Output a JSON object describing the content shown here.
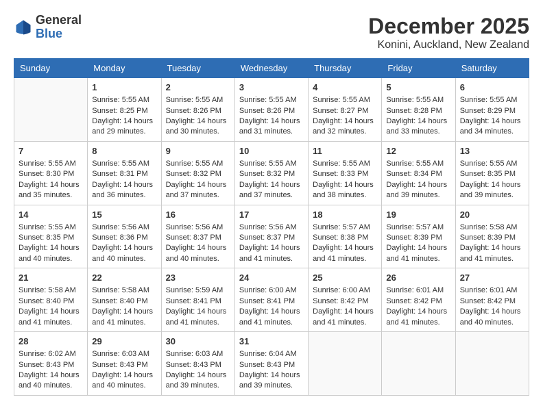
{
  "header": {
    "logo_general": "General",
    "logo_blue": "Blue",
    "month_title": "December 2025",
    "subtitle": "Konini, Auckland, New Zealand"
  },
  "days_of_week": [
    "Sunday",
    "Monday",
    "Tuesday",
    "Wednesday",
    "Thursday",
    "Friday",
    "Saturday"
  ],
  "weeks": [
    [
      {
        "day": "",
        "empty": true,
        "lines": []
      },
      {
        "day": "1",
        "lines": [
          "Sunrise: 5:55 AM",
          "Sunset: 8:25 PM",
          "Daylight: 14 hours",
          "and 29 minutes."
        ]
      },
      {
        "day": "2",
        "lines": [
          "Sunrise: 5:55 AM",
          "Sunset: 8:26 PM",
          "Daylight: 14 hours",
          "and 30 minutes."
        ]
      },
      {
        "day": "3",
        "lines": [
          "Sunrise: 5:55 AM",
          "Sunset: 8:26 PM",
          "Daylight: 14 hours",
          "and 31 minutes."
        ]
      },
      {
        "day": "4",
        "lines": [
          "Sunrise: 5:55 AM",
          "Sunset: 8:27 PM",
          "Daylight: 14 hours",
          "and 32 minutes."
        ]
      },
      {
        "day": "5",
        "lines": [
          "Sunrise: 5:55 AM",
          "Sunset: 8:28 PM",
          "Daylight: 14 hours",
          "and 33 minutes."
        ]
      },
      {
        "day": "6",
        "lines": [
          "Sunrise: 5:55 AM",
          "Sunset: 8:29 PM",
          "Daylight: 14 hours",
          "and 34 minutes."
        ]
      }
    ],
    [
      {
        "day": "7",
        "lines": [
          "Sunrise: 5:55 AM",
          "Sunset: 8:30 PM",
          "Daylight: 14 hours",
          "and 35 minutes."
        ]
      },
      {
        "day": "8",
        "lines": [
          "Sunrise: 5:55 AM",
          "Sunset: 8:31 PM",
          "Daylight: 14 hours",
          "and 36 minutes."
        ]
      },
      {
        "day": "9",
        "lines": [
          "Sunrise: 5:55 AM",
          "Sunset: 8:32 PM",
          "Daylight: 14 hours",
          "and 37 minutes."
        ]
      },
      {
        "day": "10",
        "lines": [
          "Sunrise: 5:55 AM",
          "Sunset: 8:32 PM",
          "Daylight: 14 hours",
          "and 37 minutes."
        ]
      },
      {
        "day": "11",
        "lines": [
          "Sunrise: 5:55 AM",
          "Sunset: 8:33 PM",
          "Daylight: 14 hours",
          "and 38 minutes."
        ]
      },
      {
        "day": "12",
        "lines": [
          "Sunrise: 5:55 AM",
          "Sunset: 8:34 PM",
          "Daylight: 14 hours",
          "and 39 minutes."
        ]
      },
      {
        "day": "13",
        "lines": [
          "Sunrise: 5:55 AM",
          "Sunset: 8:35 PM",
          "Daylight: 14 hours",
          "and 39 minutes."
        ]
      }
    ],
    [
      {
        "day": "14",
        "lines": [
          "Sunrise: 5:55 AM",
          "Sunset: 8:35 PM",
          "Daylight: 14 hours",
          "and 40 minutes."
        ]
      },
      {
        "day": "15",
        "lines": [
          "Sunrise: 5:56 AM",
          "Sunset: 8:36 PM",
          "Daylight: 14 hours",
          "and 40 minutes."
        ]
      },
      {
        "day": "16",
        "lines": [
          "Sunrise: 5:56 AM",
          "Sunset: 8:37 PM",
          "Daylight: 14 hours",
          "and 40 minutes."
        ]
      },
      {
        "day": "17",
        "lines": [
          "Sunrise: 5:56 AM",
          "Sunset: 8:37 PM",
          "Daylight: 14 hours",
          "and 41 minutes."
        ]
      },
      {
        "day": "18",
        "lines": [
          "Sunrise: 5:57 AM",
          "Sunset: 8:38 PM",
          "Daylight: 14 hours",
          "and 41 minutes."
        ]
      },
      {
        "day": "19",
        "lines": [
          "Sunrise: 5:57 AM",
          "Sunset: 8:39 PM",
          "Daylight: 14 hours",
          "and 41 minutes."
        ]
      },
      {
        "day": "20",
        "lines": [
          "Sunrise: 5:58 AM",
          "Sunset: 8:39 PM",
          "Daylight: 14 hours",
          "and 41 minutes."
        ]
      }
    ],
    [
      {
        "day": "21",
        "lines": [
          "Sunrise: 5:58 AM",
          "Sunset: 8:40 PM",
          "Daylight: 14 hours",
          "and 41 minutes."
        ]
      },
      {
        "day": "22",
        "lines": [
          "Sunrise: 5:58 AM",
          "Sunset: 8:40 PM",
          "Daylight: 14 hours",
          "and 41 minutes."
        ]
      },
      {
        "day": "23",
        "lines": [
          "Sunrise: 5:59 AM",
          "Sunset: 8:41 PM",
          "Daylight: 14 hours",
          "and 41 minutes."
        ]
      },
      {
        "day": "24",
        "lines": [
          "Sunrise: 6:00 AM",
          "Sunset: 8:41 PM",
          "Daylight: 14 hours",
          "and 41 minutes."
        ]
      },
      {
        "day": "25",
        "lines": [
          "Sunrise: 6:00 AM",
          "Sunset: 8:42 PM",
          "Daylight: 14 hours",
          "and 41 minutes."
        ]
      },
      {
        "day": "26",
        "lines": [
          "Sunrise: 6:01 AM",
          "Sunset: 8:42 PM",
          "Daylight: 14 hours",
          "and 41 minutes."
        ]
      },
      {
        "day": "27",
        "lines": [
          "Sunrise: 6:01 AM",
          "Sunset: 8:42 PM",
          "Daylight: 14 hours",
          "and 40 minutes."
        ]
      }
    ],
    [
      {
        "day": "28",
        "lines": [
          "Sunrise: 6:02 AM",
          "Sunset: 8:43 PM",
          "Daylight: 14 hours",
          "and 40 minutes."
        ]
      },
      {
        "day": "29",
        "lines": [
          "Sunrise: 6:03 AM",
          "Sunset: 8:43 PM",
          "Daylight: 14 hours",
          "and 40 minutes."
        ]
      },
      {
        "day": "30",
        "lines": [
          "Sunrise: 6:03 AM",
          "Sunset: 8:43 PM",
          "Daylight: 14 hours",
          "and 39 minutes."
        ]
      },
      {
        "day": "31",
        "lines": [
          "Sunrise: 6:04 AM",
          "Sunset: 8:43 PM",
          "Daylight: 14 hours",
          "and 39 minutes."
        ]
      },
      {
        "day": "",
        "empty": true,
        "lines": []
      },
      {
        "day": "",
        "empty": true,
        "lines": []
      },
      {
        "day": "",
        "empty": true,
        "lines": []
      }
    ]
  ]
}
